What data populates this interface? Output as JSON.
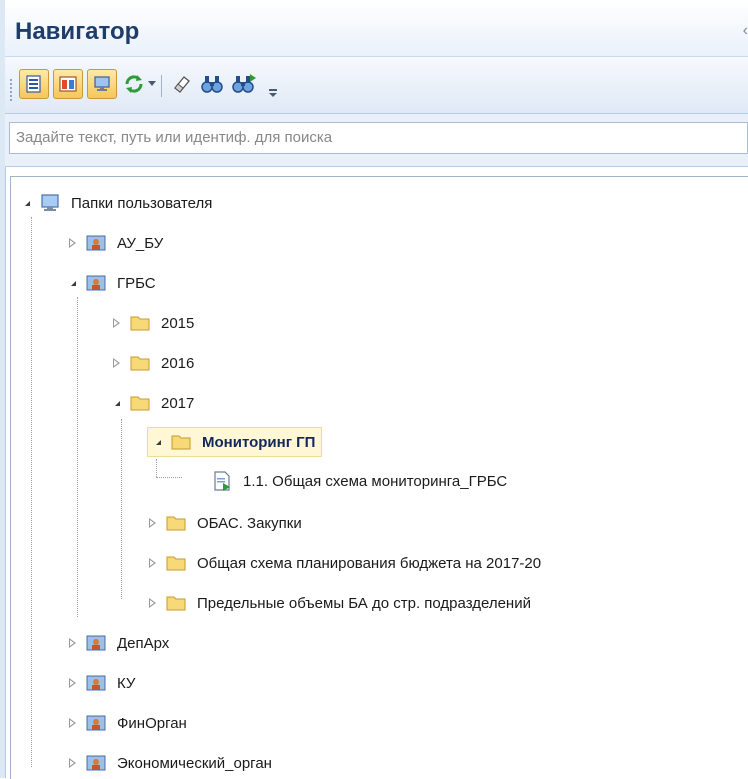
{
  "header": {
    "title": "Навигатор"
  },
  "toolbar": {
    "buttons": [
      {
        "name": "view-folders-icon"
      },
      {
        "name": "view-objects-icon"
      },
      {
        "name": "view-computer-icon"
      },
      {
        "name": "refresh-icon"
      },
      {
        "name": "clear-icon"
      },
      {
        "name": "find-icon"
      },
      {
        "name": "find-next-icon"
      }
    ]
  },
  "search": {
    "placeholder": "Задайте текст, путь или идентиф. для поиска"
  },
  "tree": {
    "root": "Папки пользователя",
    "items": [
      {
        "label": "АУ_БУ"
      },
      {
        "label": "ГРБС"
      },
      {
        "label": "2015"
      },
      {
        "label": "2016"
      },
      {
        "label": "2017"
      },
      {
        "label": "Мониторинг ГП"
      },
      {
        "label": "1.1. Общая схема мониторинга_ГРБС"
      },
      {
        "label": "ОБАС. Закупки"
      },
      {
        "label": "Общая схема планирования бюджета на 2017-20"
      },
      {
        "label": "Предельные объемы БА до стр. подразделений"
      },
      {
        "label": "ДепАрх"
      },
      {
        "label": "КУ"
      },
      {
        "label": "ФинОрган"
      },
      {
        "label": "Экономический_орган"
      }
    ]
  },
  "colors": {
    "title": "#1f3d6b",
    "selection": "#fff7d6",
    "folder": "#f5d26b",
    "toolbar_active": "#f7c659"
  }
}
